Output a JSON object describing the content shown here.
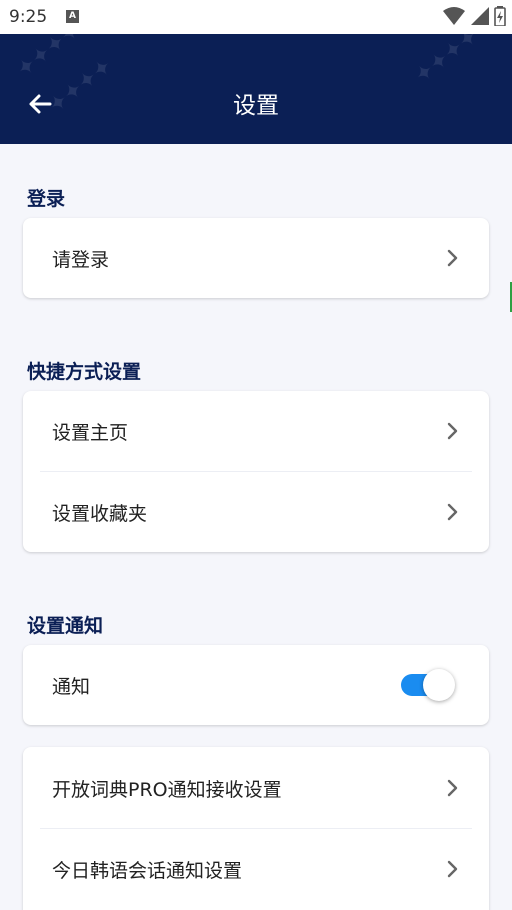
{
  "status_bar": {
    "time": "9:25",
    "a_icon": "A",
    "icons": [
      "wifi-icon",
      "signal-icon",
      "battery-icon"
    ]
  },
  "header": {
    "title": "设置",
    "back_icon": "arrow-left-icon",
    "background": "#0b1f55"
  },
  "sections": {
    "login": {
      "title": "登录",
      "items": [
        {
          "label": "请登录"
        }
      ]
    },
    "shortcuts": {
      "title": "快捷方式设置",
      "items": [
        {
          "label": "设置主页"
        },
        {
          "label": "设置收藏夹"
        }
      ]
    },
    "notifications": {
      "title": "设置通知",
      "toggle_item": {
        "label": "通知",
        "enabled": true
      },
      "items": [
        {
          "label": "开放词典PRO通知接收设置"
        },
        {
          "label": "今日韩语会话通知设置"
        }
      ]
    }
  },
  "colors": {
    "accent": "#1a8cf0",
    "section_title": "#0b1f55",
    "page_background": "#f5f6fb"
  }
}
